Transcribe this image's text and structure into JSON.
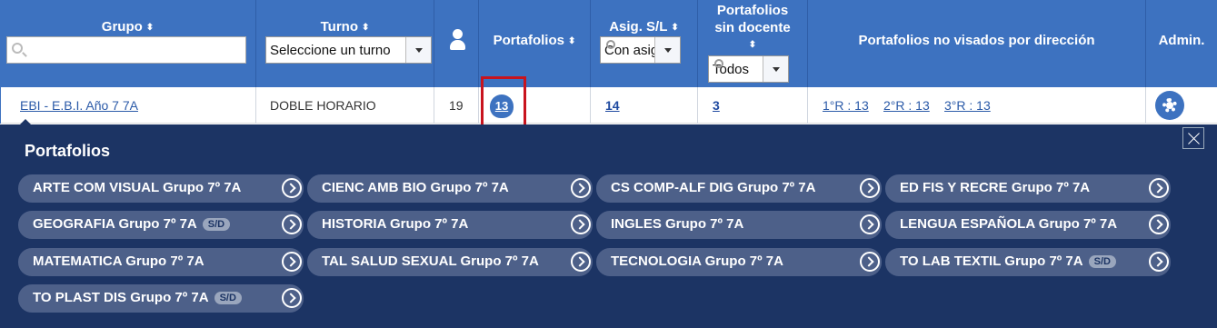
{
  "header": {
    "grupo": "Grupo",
    "turno": "Turno",
    "turno_placeholder": "Seleccione un turno",
    "portafolios": "Portafolios",
    "asig_sl": "Asig. S/L",
    "asig_value": "Con asig",
    "sin_docente_1": "Portafolios",
    "sin_docente_2": "sin docente",
    "sin_docente_select": "Todos",
    "no_visados": "Portafolios no visados por dirección",
    "admin": "Admin."
  },
  "row": {
    "grupo_link": "EBI - E.B.I. Año 7 7A",
    "turno": "DOBLE HORARIO",
    "count": "19",
    "portafolios": "13",
    "asig": "14",
    "sin_docente": "3",
    "visados": [
      "1°R : 13",
      "2°R : 13",
      "3°R : 13"
    ]
  },
  "panel": {
    "title": "Portafolios",
    "items": [
      {
        "label": "ARTE COM VISUAL Grupo 7º 7A",
        "badge": ""
      },
      {
        "label": "CIENC AMB BIO Grupo 7º 7A",
        "badge": ""
      },
      {
        "label": "CS COMP-ALF DIG Grupo 7º 7A",
        "badge": ""
      },
      {
        "label": "ED FIS Y RECRE Grupo 7º 7A",
        "badge": ""
      },
      {
        "label": "GEOGRAFIA Grupo 7º 7A",
        "badge": "S/D"
      },
      {
        "label": "HISTORIA Grupo 7º 7A",
        "badge": ""
      },
      {
        "label": "INGLES Grupo 7º 7A",
        "badge": ""
      },
      {
        "label": "LENGUA ESPAÑOLA Grupo 7º 7A",
        "badge": ""
      },
      {
        "label": "MATEMATICA Grupo 7º 7A",
        "badge": ""
      },
      {
        "label": "TAL SALUD SEXUAL Grupo 7º 7A",
        "badge": ""
      },
      {
        "label": "TECNOLOGIA Grupo 7º 7A",
        "badge": ""
      },
      {
        "label": "TO LAB TEXTIL Grupo 7º 7A",
        "badge": "S/D"
      },
      {
        "label": "TO PLAST DIS Grupo 7º 7A",
        "badge": "S/D"
      }
    ]
  },
  "icons": {
    "sort": "sort-icon",
    "user": "user-icon",
    "search": "search-icon",
    "gear": "gear-icon",
    "close": "close-icon",
    "arrow": "chevron-right-circle-icon"
  },
  "colors": {
    "header_bg": "#3d72c0",
    "panel_bg": "#1c3464",
    "pill_bg": "#4d6089",
    "highlight": "#c8141e"
  }
}
